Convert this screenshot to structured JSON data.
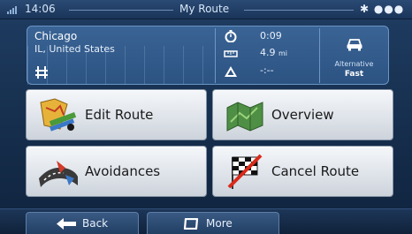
{
  "status_bar": {
    "time": "14:06",
    "title": "My Route",
    "indicators": "✱ ●●●"
  },
  "route_info": {
    "destination_city": "Chicago",
    "destination_country": "IL, United States",
    "time_remaining": "0:09",
    "distance_value": "4.9",
    "distance_unit": "mi",
    "next_event": "-:--",
    "route_type_label": "Alternative",
    "route_type_value": "Fast"
  },
  "menu": {
    "edit_route": "Edit Route",
    "overview": "Overview",
    "avoidances": "Avoidances",
    "cancel_route": "Cancel Route"
  },
  "bottom": {
    "back": "Back",
    "more": "More"
  }
}
